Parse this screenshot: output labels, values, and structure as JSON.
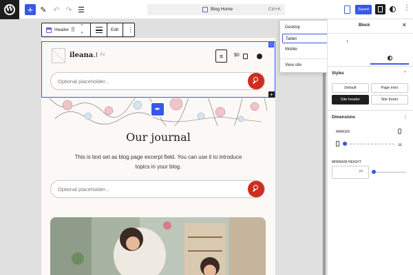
{
  "editor": {
    "document_title": "Blog Home",
    "shortcut": "Ctrl+K",
    "save_label": "Saved",
    "accent_color": "#3858e9"
  },
  "block_toolbar": {
    "block_label": "Header",
    "edit_label": "Edit"
  },
  "preview_menu": {
    "items": [
      {
        "label": "Desktop",
        "selected": false
      },
      {
        "label": "Tablet",
        "selected": true
      },
      {
        "label": "Mobile",
        "selected": false
      }
    ],
    "view_site_label": "View site"
  },
  "canvas": {
    "site_title": "ileana",
    "site_title_dot": ".",
    "tagline": "Ac",
    "cart_total": "$0",
    "search_placeholder_1": "Optional placeholder...",
    "search_placeholder_2": "Optional placeholder...",
    "journal_title": "Our journal",
    "journal_excerpt": "This is text set as blog page excerpt field. You can use it to introduce topics in your blog.",
    "brand_red": "#d02c20"
  },
  "sidebar": {
    "tab_block": "Block",
    "stub_text": "r",
    "styles_heading": "Styles",
    "style_options": [
      {
        "label": "Default",
        "active": false
      },
      {
        "label": "Page intro",
        "active": false
      },
      {
        "label": "Site header",
        "active": true
      },
      {
        "label": "Site footer",
        "active": false
      }
    ],
    "dimensions_heading": "Dimensions",
    "margin_label": "MARGIN",
    "min_height_label": "MINIMUM HEIGHT",
    "min_height_unit": "px"
  }
}
